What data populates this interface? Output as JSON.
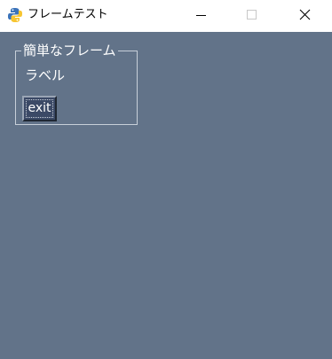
{
  "window": {
    "title": "フレームテスト",
    "app_icon": "python-feather-icon",
    "controls": {
      "minimize_icon": "minimize-icon",
      "maximize_icon": "maximize-icon",
      "close_icon": "close-icon"
    }
  },
  "frame": {
    "title": "簡単なフレーム",
    "label_text": "ラベル",
    "exit_button_label": "exit"
  },
  "colors": {
    "client_background": "#627389",
    "button_background": "#3b4966",
    "text": "#ffffff",
    "titlebar": "#ffffff"
  }
}
